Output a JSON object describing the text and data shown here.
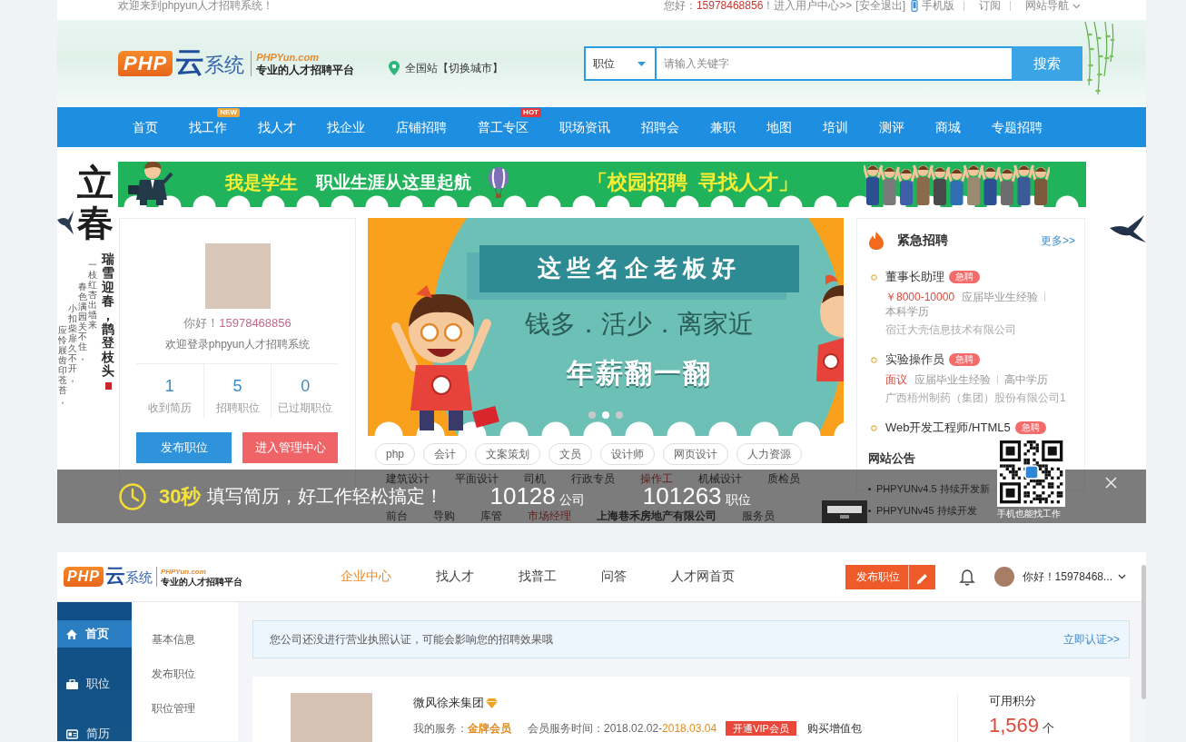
{
  "top_bar": {
    "welcome": "欢迎来到phpyun人才招聘系统！",
    "greeting": "您好：",
    "phone": "15978468856",
    "user_center": "！进入用户中心>>",
    "logout": "[安全退出]",
    "links": [
      {
        "label": "手机版",
        "kind": "mobile"
      },
      {
        "label": "订阅",
        "kind": "plain"
      },
      {
        "label": "网站导航",
        "kind": "dropdown"
      }
    ]
  },
  "header": {
    "logo": {
      "mark": "PHP",
      "name": "云系统",
      "domain": "PHPYun.com",
      "slogan": "专业的人才招聘平台"
    },
    "location": "全国站【切换城市】",
    "search": {
      "category": "职位",
      "placeholder": "请输入关键字",
      "button": "搜索"
    }
  },
  "nav": [
    {
      "label": "首页"
    },
    {
      "label": "找工作",
      "badge": {
        "text": "NEW",
        "color": "#eda53c"
      }
    },
    {
      "label": "找人才"
    },
    {
      "label": "找企业"
    },
    {
      "label": "店铺招聘"
    },
    {
      "label": "普工专区",
      "badge": {
        "text": "HOT",
        "color": "#e5383b"
      }
    },
    {
      "label": "职场资讯"
    },
    {
      "label": "招聘会"
    },
    {
      "label": "兼职"
    },
    {
      "label": "地图"
    },
    {
      "label": "培训"
    },
    {
      "label": "测评"
    },
    {
      "label": "商城"
    },
    {
      "label": "专题招聘"
    }
  ],
  "decoration": {
    "calligraphy": "立春",
    "motto": "瑞雪迎春，鹊登枝头",
    "poem": [
      "应怜屐齿印苍苔，",
      "小扣柴扉久不开，",
      "春色满园关不住，",
      "一枝红杏出墙来"
    ]
  },
  "banner": {
    "left_title": "我是学生",
    "left_text": "职业生涯从这里起航",
    "right_title": "「校园招聘",
    "right_text": "寻找人才」"
  },
  "user_panel": {
    "greeting": "你好！",
    "phone": "15978468856",
    "welcome": "欢迎登录phpyun人才招聘系统",
    "stats": [
      {
        "value": "1",
        "label": "收到简历"
      },
      {
        "value": "5",
        "label": "招聘职位"
      },
      {
        "value": "0",
        "label": "已过期职位"
      }
    ],
    "buttons": [
      {
        "label": "发布职位",
        "kind": "primary"
      },
      {
        "label": "进入管理中心",
        "kind": "danger"
      }
    ]
  },
  "carousel": {
    "ribbon": "这些名企老板好",
    "slogan": "钱多．活少．离家近",
    "headline": "年薪翻一翻",
    "dots": [
      {
        "selected": false
      },
      {
        "selected": true
      },
      {
        "selected": false
      }
    ]
  },
  "job_tags": [
    {
      "kind": "pill",
      "tags": [
        {
          "label": "php",
          "kind": "job",
          "hot": false
        },
        {
          "label": "会计",
          "kind": "job",
          "hot": false
        },
        {
          "label": "文案策划",
          "kind": "job",
          "hot": false
        },
        {
          "label": "文员",
          "kind": "job",
          "hot": false
        },
        {
          "label": "设计师",
          "kind": "job",
          "hot": false
        },
        {
          "label": "网页设计",
          "kind": "job",
          "hot": false
        },
        {
          "label": "人力资源",
          "kind": "job",
          "hot": false
        }
      ]
    },
    {
      "kind": "plain",
      "tags": [
        {
          "label": "建筑设计",
          "kind": "job",
          "hot": false
        },
        {
          "label": "平面设计",
          "kind": "job",
          "hot": false
        },
        {
          "label": "司机",
          "kind": "job",
          "hot": false
        },
        {
          "label": "行政专员",
          "kind": "job",
          "hot": false
        },
        {
          "label": "操作工",
          "kind": "job",
          "hot": true
        },
        {
          "label": "机械设计",
          "kind": "job",
          "hot": false
        },
        {
          "label": "质检员",
          "kind": "job",
          "hot": false
        }
      ]
    },
    {
      "kind": "plain",
      "tags": [
        {
          "label": "前台",
          "kind": "job",
          "hot": false
        },
        {
          "label": "导购",
          "kind": "job",
          "hot": false
        },
        {
          "label": "库管",
          "kind": "job",
          "hot": false
        },
        {
          "label": "市场经理",
          "kind": "job",
          "hot": true
        },
        {
          "label": "上海巷禾房地产有限公司",
          "kind": "company",
          "hot": false
        },
        {
          "label": "服务员",
          "kind": "job",
          "hot": false
        }
      ]
    }
  ],
  "urgent_jobs": {
    "title": "紧急招聘",
    "more": "更多>>",
    "items": [
      {
        "title": "董事长助理",
        "badge": "急聘",
        "salary": "￥8000-10000",
        "experience": "应届毕业生经验",
        "education": "本科学历",
        "company": "宿迁大壳信息技术有限公司"
      },
      {
        "title": "实验操作员",
        "badge": "急聘",
        "salary": "面议",
        "experience": "应届毕业生经验",
        "education": "高中学历",
        "company": "广西梧州制药（集团）股份有限公司1"
      },
      {
        "title": "Web开发工程师/HTML5",
        "badge": "急聘"
      }
    ]
  },
  "notices": {
    "title": "网站公告",
    "items": [
      "PHPYUNv4.5 持续开发新",
      "PHPYUNv45 持续开发"
    ]
  },
  "promo_bar": {
    "seconds": "30秒",
    "text": "填写简历，好工作轻松搞定！",
    "stats": [
      {
        "value": "10128",
        "unit": "公司"
      },
      {
        "value": "101263",
        "unit": "职位"
      }
    ]
  },
  "qr_popup": {
    "caption": "手机也能找工作"
  },
  "company_center": {
    "logo": {
      "mark": "PHP",
      "name": "云系统",
      "domain": "PHPYun.com",
      "slogan": "专业的人才招聘平台"
    },
    "nav": [
      {
        "label": "企业中心",
        "selected": true
      },
      {
        "label": "找人才",
        "selected": false
      },
      {
        "label": "找普工",
        "selected": false
      },
      {
        "label": "问答",
        "selected": false
      },
      {
        "label": "人才网首页",
        "selected": false
      }
    ],
    "post_button": "发布职位",
    "user_menu": "你好！15978468...",
    "sidebar": [
      {
        "label": "首页",
        "selected": true
      },
      {
        "label": "职位",
        "selected": false
      },
      {
        "label": "简历",
        "selected": false
      }
    ],
    "subnav": [
      "基本信息",
      "发布职位",
      "职位管理"
    ],
    "notice": {
      "text": "您公司还没进行营业执照认证，可能会影响您的招聘效果哦",
      "link": "立即认证>>"
    },
    "company": {
      "name": "微风徐来集团",
      "service_label": "我的服务：",
      "service_level": "金牌会员",
      "period": "会员服务时间：2018.02.02-",
      "period_end": "2018.03.04",
      "vip_button": "开通VIP会员",
      "addon_link": "购买增值包",
      "points_label": "可用积分",
      "points": "1,569",
      "points_unit": "个"
    }
  }
}
